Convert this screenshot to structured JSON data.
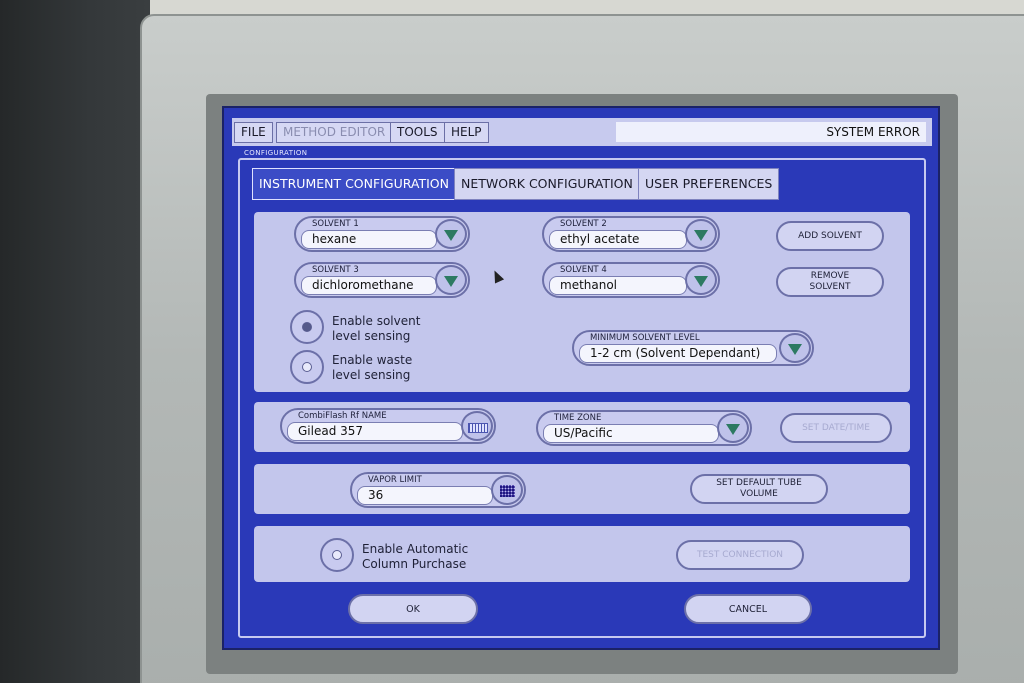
{
  "menu": {
    "file": "FILE",
    "method_editor": "METHOD EDITOR",
    "tools": "TOOLS",
    "help": "HELP",
    "status": "SYSTEM ERROR"
  },
  "section_label": "CONFIGURATION",
  "tabs": [
    {
      "label": "INSTRUMENT CONFIGURATION",
      "active": true
    },
    {
      "label": "NETWORK CONFIGURATION",
      "active": false
    },
    {
      "label": "USER PREFERENCES",
      "active": false
    }
  ],
  "solvents": [
    {
      "label": "SOLVENT 1",
      "value": "hexane"
    },
    {
      "label": "SOLVENT 2",
      "value": "ethyl acetate"
    },
    {
      "label": "SOLVENT 3",
      "value": "dichloromethane"
    },
    {
      "label": "SOLVENT 4",
      "value": "methanol"
    }
  ],
  "buttons": {
    "add_solvent": "ADD SOLVENT",
    "remove_solvent": "REMOVE SOLVENT",
    "set_date_time": "SET DATE/TIME",
    "set_default_tube_volume": "SET DEFAULT TUBE VOLUME",
    "test_connection": "TEST CONNECTION",
    "ok": "OK",
    "cancel": "CANCEL"
  },
  "options": {
    "solvent_sensing": "Enable solvent level sensing",
    "waste_sensing": "Enable waste level sensing",
    "auto_column_purchase": "Enable Automatic Column Purchase"
  },
  "min_solvent_level": {
    "label": "MINIMUM SOLVENT LEVEL",
    "value": "1-2 cm (Solvent Dependant)"
  },
  "instrument_name": {
    "label": "CombiFlash Rf NAME",
    "value": "Gilead 357"
  },
  "time_zone": {
    "label": "TIME ZONE",
    "value": "US/Pacific"
  },
  "vapor_limit": {
    "label": "VAPOR LIMIT",
    "value": "36"
  },
  "colors": {
    "screen": "#2a39b8",
    "panel": "#c3c6ec",
    "active_tab": "#3b4cc6",
    "arrow": "#2d7a62"
  }
}
